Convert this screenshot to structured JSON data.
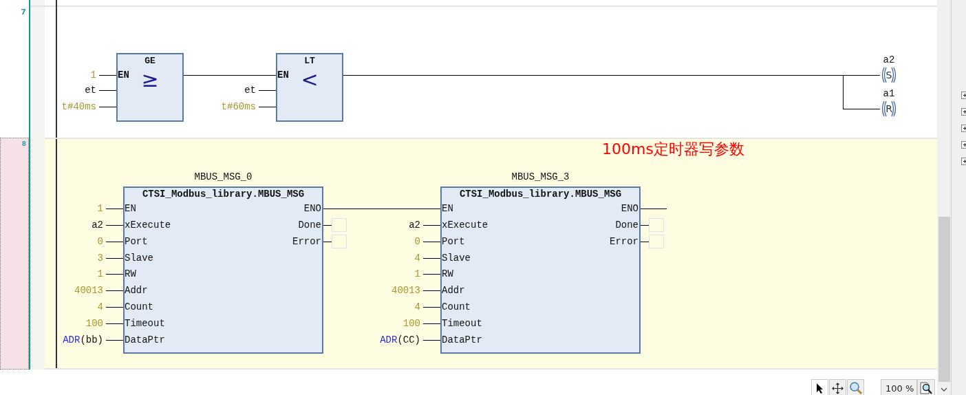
{
  "networks": [
    {
      "number": "7",
      "selected": false,
      "blocks": [
        {
          "kind": "compare",
          "title": "GE",
          "symbol": "≥",
          "inputs": [
            {
              "pin": "EN",
              "value": "1",
              "kind": "literal"
            },
            {
              "value": "et",
              "kind": "variable"
            },
            {
              "value": "t#40ms",
              "kind": "literal"
            }
          ]
        },
        {
          "kind": "compare",
          "title": "LT",
          "symbol": "<",
          "inputs": [
            {
              "pin": "EN",
              "kind": "wired"
            },
            {
              "value": "et",
              "kind": "variable"
            },
            {
              "value": "t#60ms",
              "kind": "literal"
            }
          ]
        }
      ],
      "coils": [
        {
          "variable": "a2",
          "letter": "S"
        },
        {
          "variable": "a1",
          "letter": "R"
        }
      ]
    },
    {
      "number": "8",
      "selected": true,
      "comment": "100ms定时器写参数",
      "blocks": [
        {
          "kind": "function_block",
          "instance": "MBUS_MSG_0",
          "title": "CTSI_Modbus_library.MBUS_MSG",
          "inputs": [
            {
              "pin": "EN",
              "value": "1",
              "kind": "literal"
            },
            {
              "pin": "xExecute",
              "value": "a2",
              "kind": "variable"
            },
            {
              "pin": "Port",
              "value": "0",
              "kind": "literal"
            },
            {
              "pin": "Slave",
              "value": "3",
              "kind": "literal"
            },
            {
              "pin": "RW",
              "value": "1",
              "kind": "literal"
            },
            {
              "pin": "Addr",
              "value": "40013",
              "kind": "literal"
            },
            {
              "pin": "Count",
              "value": "4",
              "kind": "literal"
            },
            {
              "pin": "Timeout",
              "value": "100",
              "kind": "literal"
            },
            {
              "pin": "DataPtr",
              "value": "ADR",
              "arg": "(bb)",
              "kind": "address"
            }
          ],
          "outputs": [
            {
              "pin": "ENO",
              "kind": "wire"
            },
            {
              "pin": "Done",
              "kind": "empty_box"
            },
            {
              "pin": "Error",
              "kind": "empty_box"
            }
          ]
        },
        {
          "kind": "function_block",
          "instance": "MBUS_MSG_3",
          "title": "CTSI_Modbus_library.MBUS_MSG",
          "inputs": [
            {
              "pin": "EN",
              "kind": "wired"
            },
            {
              "pin": "xExecute",
              "value": "a2",
              "kind": "variable"
            },
            {
              "pin": "Port",
              "value": "0",
              "kind": "literal"
            },
            {
              "pin": "Slave",
              "value": "4",
              "kind": "literal"
            },
            {
              "pin": "RW",
              "value": "1",
              "kind": "literal"
            },
            {
              "pin": "Addr",
              "value": "40013",
              "kind": "literal"
            },
            {
              "pin": "Count",
              "value": "4",
              "kind": "literal"
            },
            {
              "pin": "Timeout",
              "value": "100",
              "kind": "literal"
            },
            {
              "pin": "DataPtr",
              "value": "ADR",
              "arg": "(CC)",
              "kind": "address"
            }
          ],
          "outputs": [
            {
              "pin": "ENO",
              "kind": "wire"
            },
            {
              "pin": "Done",
              "kind": "empty_box"
            },
            {
              "pin": "Error",
              "kind": "empty_box"
            }
          ]
        }
      ]
    }
  ],
  "toolbar": [
    {
      "kind": "pointer",
      "selected": true
    },
    {
      "kind": "move",
      "selected": false
    },
    {
      "kind": "zoom",
      "selected": false
    }
  ],
  "zoom": {
    "value": "100 %"
  }
}
